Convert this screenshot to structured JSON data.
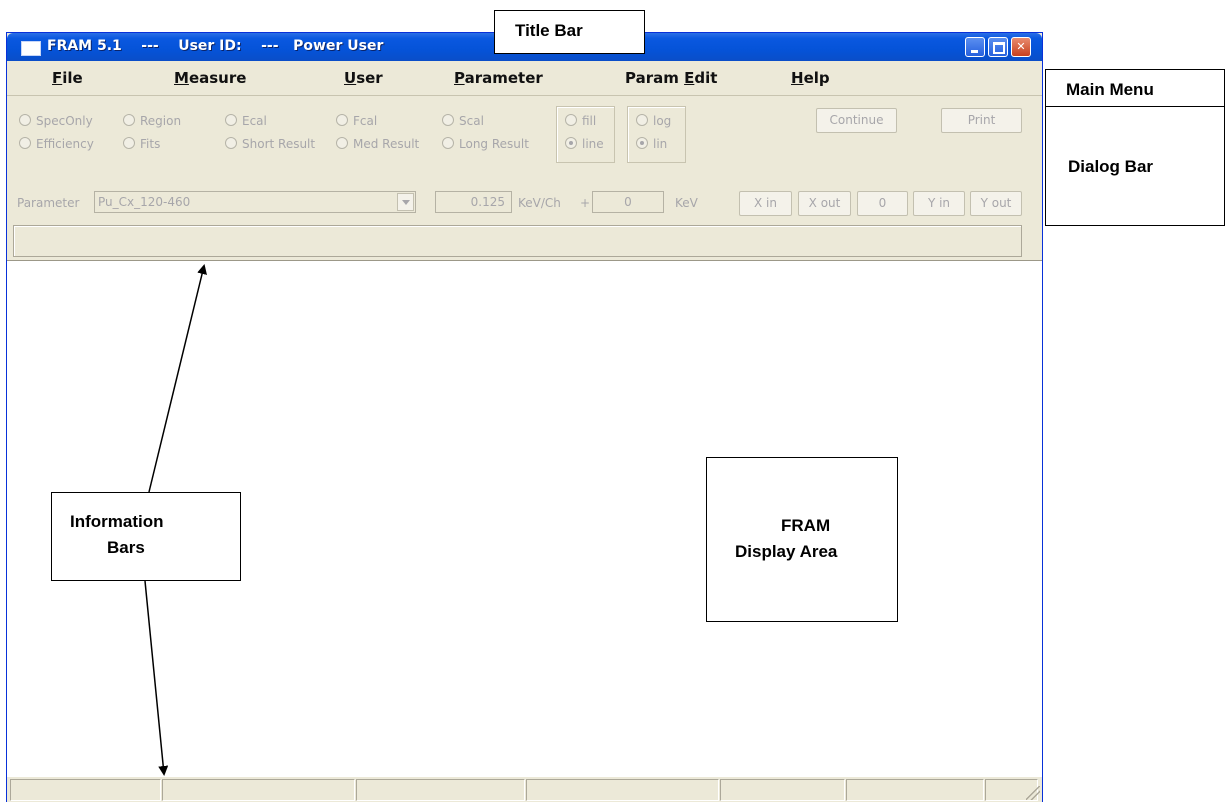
{
  "window": {
    "title": "FRAM 5.1    ---    User ID:    ---   Power User"
  },
  "menu": {
    "items": [
      "File",
      "Measure",
      "User",
      "Parameter",
      "Param Edit",
      "Help"
    ],
    "mnemonics": [
      "F",
      "M",
      "U",
      "P",
      "E",
      "H"
    ]
  },
  "dialog": {
    "radios_row1": [
      "SpecOnly",
      "Region",
      "Ecal",
      "Fcal",
      "Scal"
    ],
    "radios_row2": [
      "Efficiency",
      "Fits",
      "Short Result",
      "Med Result",
      "Long Result"
    ],
    "fill_label": "fill",
    "line_label": "line",
    "log_label": "log",
    "lin_label": "lin",
    "continue_label": "Continue",
    "print_label": "Print",
    "parameter_label": "Parameter",
    "parameter_value": "Pu_Cx_120-460",
    "kev_per_ch_value": "0.125",
    "kev_per_ch_unit": "KeV/Ch",
    "plus": "+",
    "offset_value": "0",
    "offset_unit": "KeV",
    "zoom_buttons": [
      "X in",
      "X out",
      "0",
      "Y in",
      "Y out"
    ]
  },
  "annotations": {
    "title_bar": "Title Bar",
    "main_menu": "Main Menu",
    "dialog_bar": "Dialog Bar",
    "info_bars_line1": "Information",
    "info_bars_line2": "Bars",
    "display_line1": "FRAM",
    "display_line2": "Display Area"
  }
}
